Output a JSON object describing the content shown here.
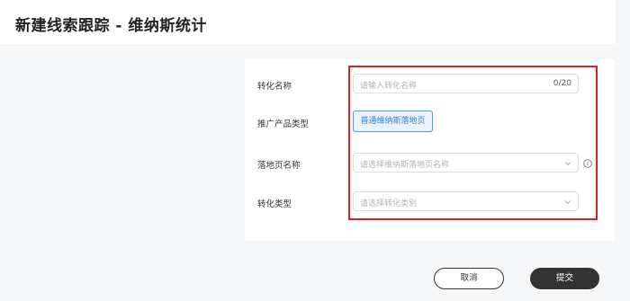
{
  "header": {
    "title": "新建线索跟踪 - 维纳斯统计"
  },
  "form": {
    "conversion_name": {
      "label": "转化名称",
      "placeholder": "请输入转化名称",
      "counter": "0/20"
    },
    "product_type": {
      "label": "推广产品类型",
      "selected": "普通维纳斯落地页"
    },
    "landing_page": {
      "label": "落地页名称",
      "placeholder": "请选择维纳斯落地页名称"
    },
    "conversion_type": {
      "label": "转化类型",
      "placeholder": "请选择转化类别"
    }
  },
  "footer": {
    "cancel_label": "取消",
    "submit_label": "提交"
  },
  "colors": {
    "accent": "#2f7fe0",
    "highlight": "#e61e1e",
    "primary_button": "#333333"
  },
  "icons": {
    "dropdown": "chevron-down-icon",
    "info": "info-circle-icon"
  }
}
